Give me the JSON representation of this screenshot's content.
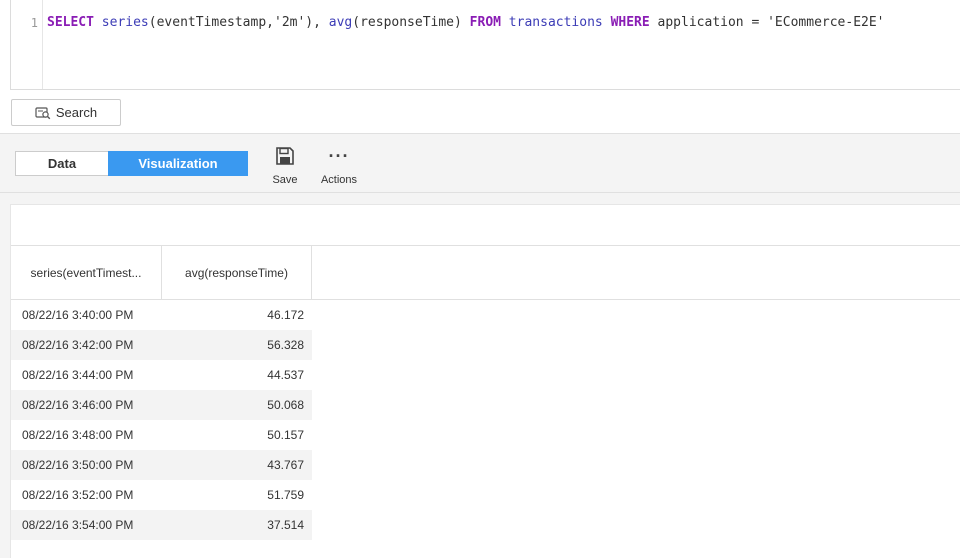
{
  "editor": {
    "line_number": "1",
    "tokens": {
      "select": "SELECT",
      "series_fn": "series",
      "series_args": "(eventTimestamp,'2m'), ",
      "avg_fn": "avg",
      "avg_args": "(responseTime) ",
      "from": "FROM",
      "table": " transactions ",
      "where": "WHERE",
      "condition": " application = 'ECommerce-E2E'"
    }
  },
  "search": {
    "label": "Search",
    "icon": "search-icon"
  },
  "tabs": [
    {
      "label": "Data",
      "active": false
    },
    {
      "label": "Visualization",
      "active": true
    }
  ],
  "toolbar": {
    "save_label": "Save",
    "actions_label": "Actions",
    "actions_glyph": "···"
  },
  "table": {
    "columns": [
      "series(eventTimest...",
      "avg(responseTime)"
    ],
    "rows": [
      {
        "ts": "08/22/16 3:40:00 PM",
        "val": "46.172"
      },
      {
        "ts": "08/22/16 3:42:00 PM",
        "val": "56.328"
      },
      {
        "ts": "08/22/16 3:44:00 PM",
        "val": "44.537"
      },
      {
        "ts": "08/22/16 3:46:00 PM",
        "val": "50.068"
      },
      {
        "ts": "08/22/16 3:48:00 PM",
        "val": "50.157"
      },
      {
        "ts": "08/22/16 3:50:00 PM",
        "val": "43.767"
      },
      {
        "ts": "08/22/16 3:52:00 PM",
        "val": "51.759"
      },
      {
        "ts": "08/22/16 3:54:00 PM",
        "val": "37.514"
      }
    ]
  },
  "colors": {
    "accent": "#3a99f0",
    "keyword": "#8a1db5",
    "function": "#3c3cb6"
  }
}
